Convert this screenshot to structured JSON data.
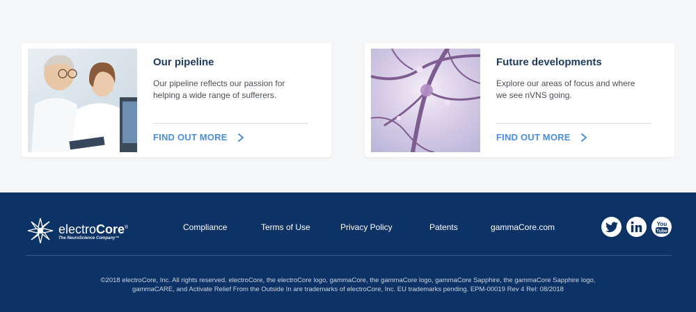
{
  "cards": [
    {
      "title": "Our pipeline",
      "text": "Our pipeline reflects our passion for helping a wide range of sufferers.",
      "link": "FIND OUT MORE",
      "image_icon": "scientists-photo"
    },
    {
      "title": "Future developments",
      "text": "Explore our areas of focus and where we see nVNS going.",
      "link": "FIND OUT MORE",
      "image_icon": "neurons-photo"
    }
  ],
  "footer": {
    "logo": {
      "name_light": "electro",
      "name_bold": "Core",
      "reg": "®",
      "tagline": "The NeuroScience Company™"
    },
    "nav": [
      "Compliance",
      "Terms of Use",
      "Privacy Policy",
      "Patents",
      "gammaCore.com"
    ],
    "social": [
      "twitter-icon",
      "linkedin-icon",
      "youtube-icon"
    ],
    "legal": "©2018 electroCore, Inc. All rights reserved. electroCore, the electroCore logo, gammaCore, the gammaCore logo, gammaCore Sapphire, the gammaCore Sapphire logo, gammaCARE, and Activate Relief From the Outside In are trademarks of electroCore, Inc. EU trademarks pending. EPM-00019 Rev 4 Rel: 08/2018",
    "youtube_label": {
      "top": "You",
      "bottom": "Tube"
    }
  },
  "colors": {
    "footer_bg": "#0d3366",
    "accent": "#4b8fd8",
    "title": "#1e3a5c",
    "page_bg": "#f5f6f8"
  }
}
